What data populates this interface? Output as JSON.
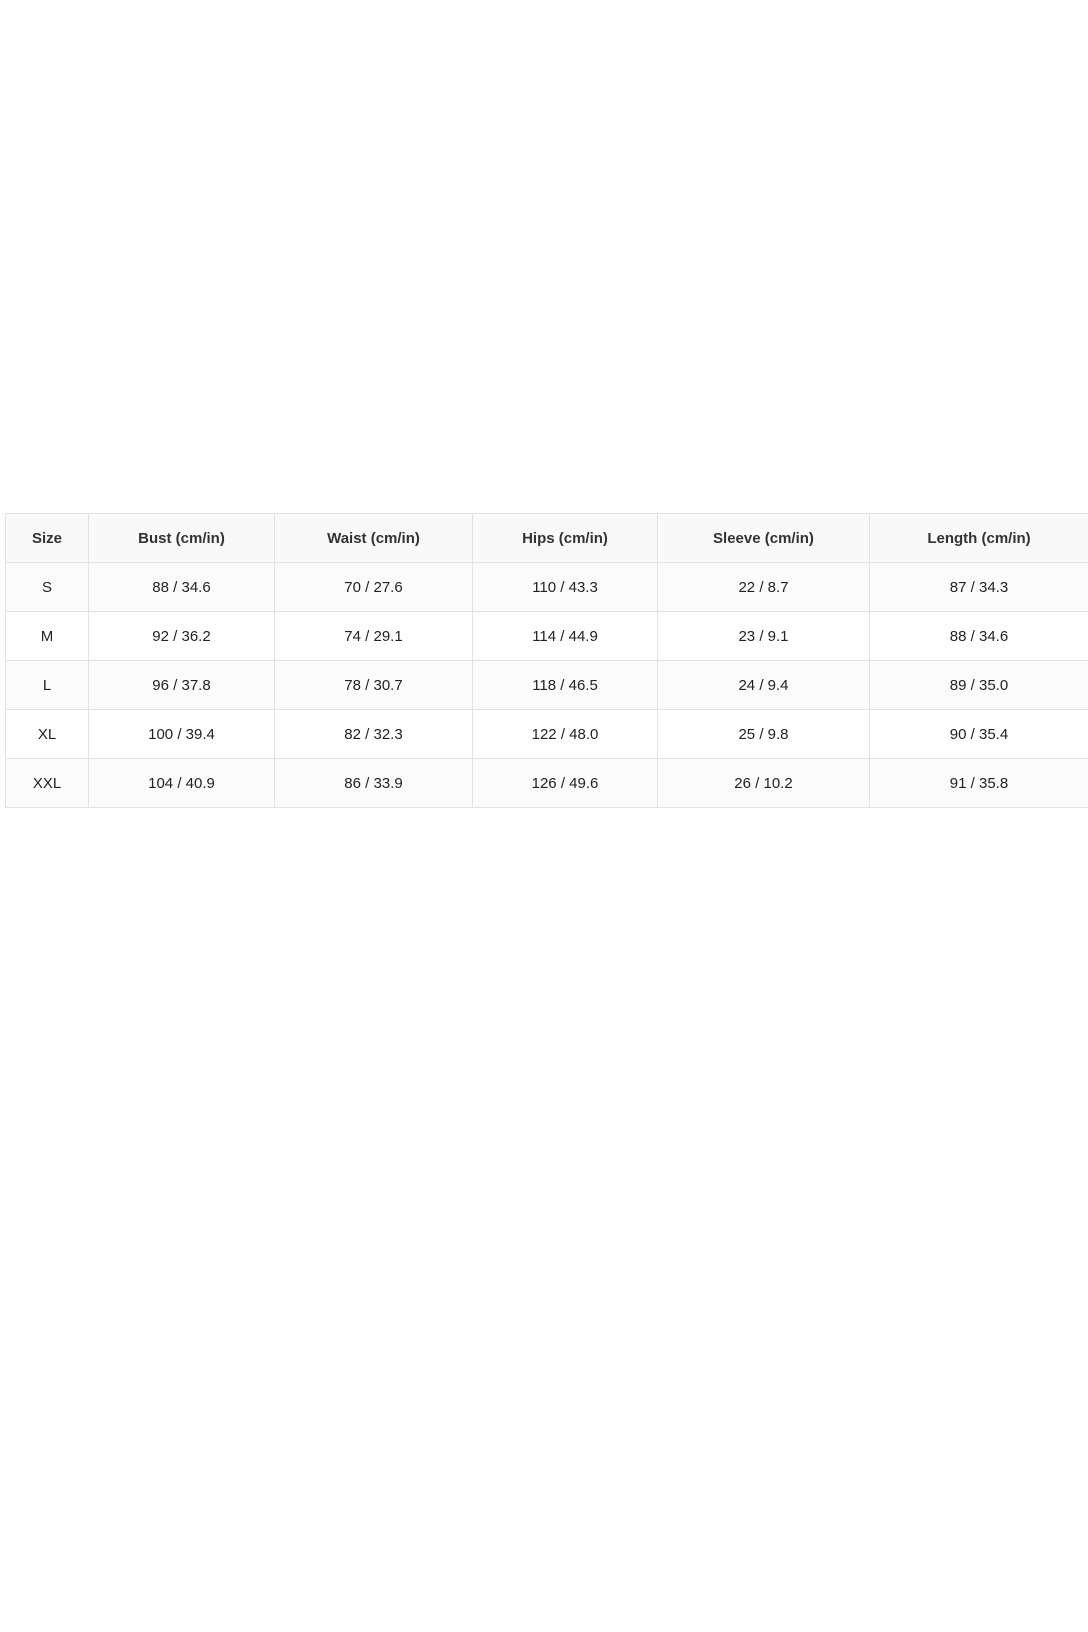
{
  "table": {
    "headers": [
      "Size",
      "Bust (cm/in)",
      "Waist (cm/in)",
      "Hips (cm/in)",
      "Sleeve (cm/in)",
      "Length (cm/in)"
    ],
    "rows": [
      [
        "S",
        "88 / 34.6",
        "70 / 27.6",
        "110 / 43.3",
        "22 / 8.7",
        "87 / 34.3"
      ],
      [
        "M",
        "92 / 36.2",
        "74 / 29.1",
        "114 / 44.9",
        "23 / 9.1",
        "88 / 34.6"
      ],
      [
        "L",
        "96 / 37.8",
        "78 / 30.7",
        "118 / 46.5",
        "24 / 9.4",
        "89 / 35.0"
      ],
      [
        "XL",
        "100 / 39.4",
        "82 / 32.3",
        "122 / 48.0",
        "25 / 9.8",
        "90 / 35.4"
      ],
      [
        "XXL",
        "104 / 40.9",
        "86 / 33.9",
        "126 / 49.6",
        "26 / 10.2",
        "91 / 35.8"
      ]
    ]
  },
  "colors": {
    "border": "#e2e2e2",
    "header_background": "#f9f9f9",
    "text": "#222222"
  }
}
